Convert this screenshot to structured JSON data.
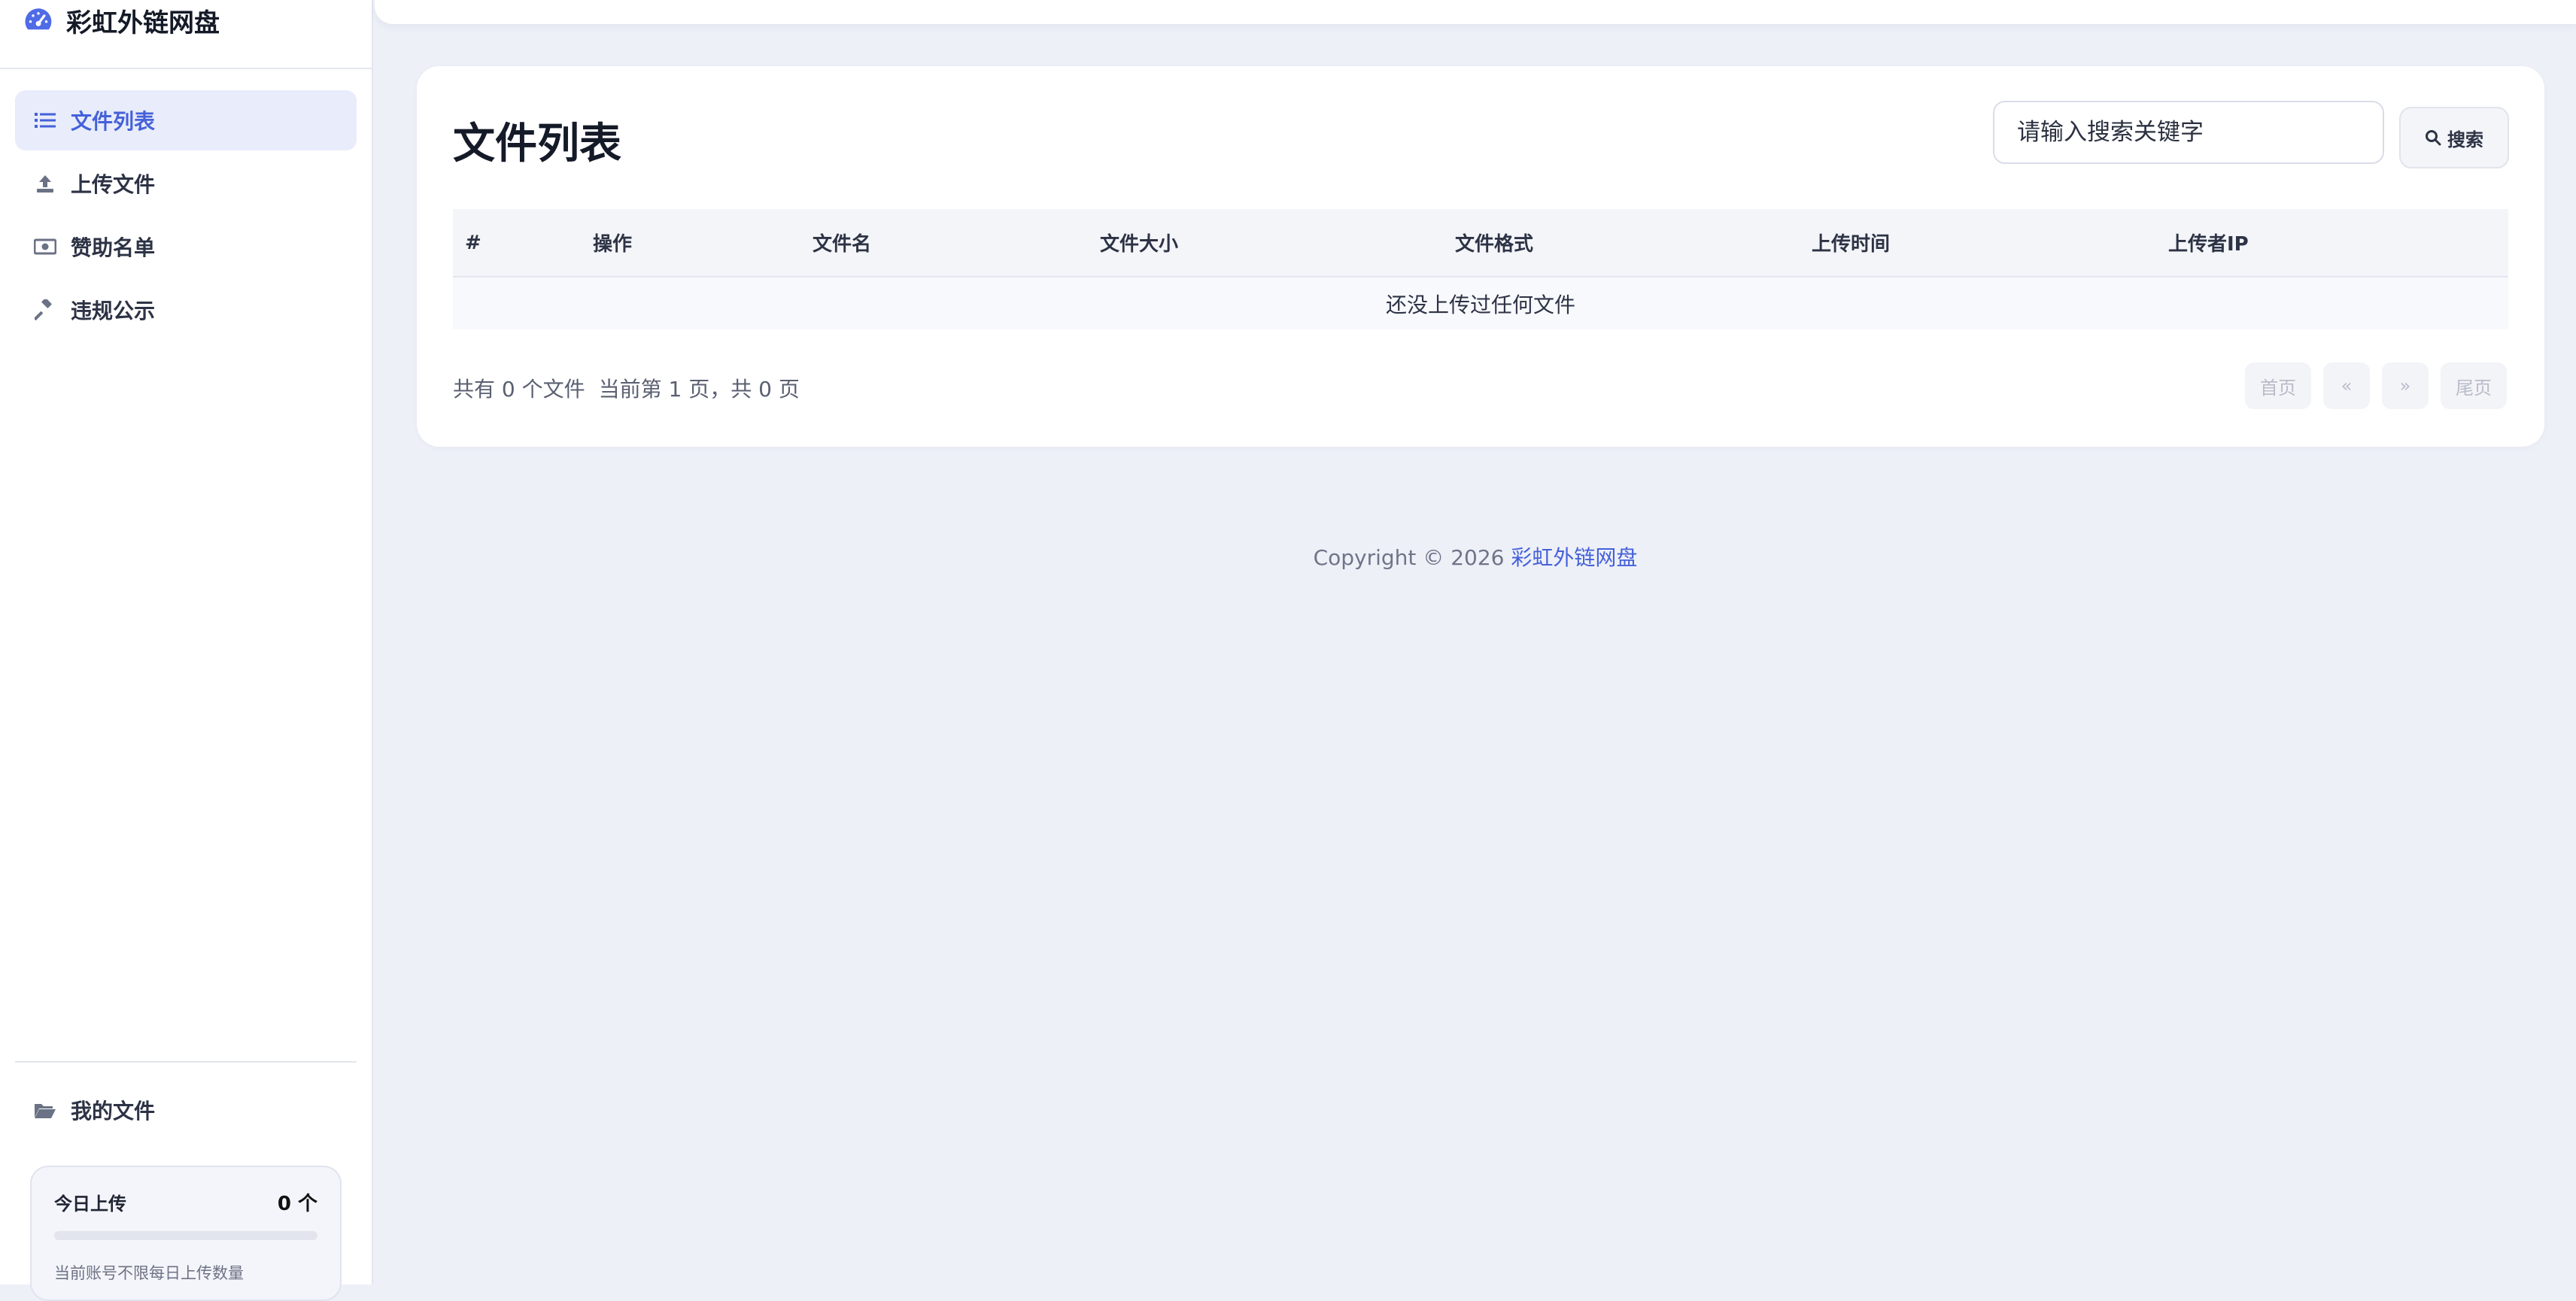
{
  "brand": {
    "name": "彩虹外链网盘",
    "icon": "gauge-icon",
    "color": "#4f6be6"
  },
  "sidebar": {
    "items": [
      {
        "label": "文件列表",
        "icon": "list-icon",
        "active": true
      },
      {
        "label": "上传文件",
        "icon": "upload-icon",
        "active": false
      },
      {
        "label": "赞助名单",
        "icon": "money-icon",
        "active": false
      },
      {
        "label": "违规公示",
        "icon": "gavel-icon",
        "active": false
      }
    ],
    "my_files": {
      "label": "我的文件",
      "icon": "folder-open-icon"
    },
    "upload_stats": {
      "title": "今日上传",
      "value": "0 个",
      "progress": 0,
      "note": "当前账号不限每日上传数量"
    }
  },
  "main": {
    "title": "文件列表",
    "search": {
      "placeholder": "请输入搜索关键字",
      "button_label": "搜索",
      "icon": "search-icon"
    },
    "table": {
      "columns": [
        "#",
        "操作",
        "文件名",
        "文件大小",
        "文件格式",
        "上传时间",
        "上传者IP"
      ],
      "empty_text": "还没上传过任何文件"
    },
    "summary": {
      "total": "共有 0 个文件",
      "page": "当前第 1 页，共 0 页"
    },
    "pagination": {
      "first": "首页",
      "prev": "«",
      "next": "»",
      "last": "尾页"
    }
  },
  "footer": {
    "copyright": "Copyright © 2026",
    "link_text": "彩虹外链网盘"
  },
  "colors": {
    "accent": "#4561d9",
    "active_bg": "#e8ecfb",
    "page_bg": "#eef0f8"
  }
}
